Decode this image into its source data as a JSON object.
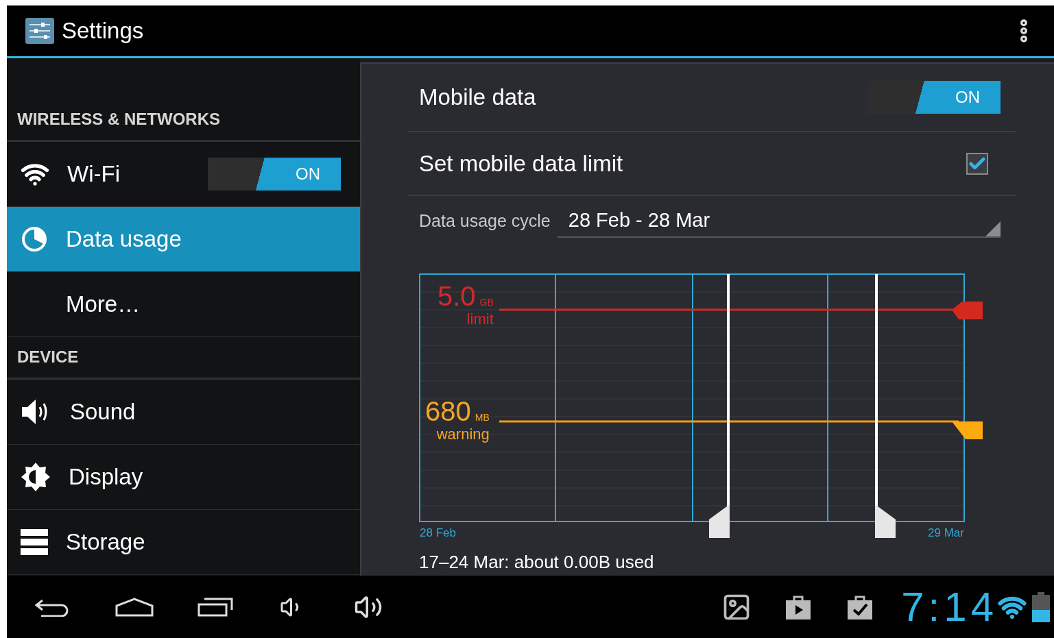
{
  "app_bar": {
    "title": "Settings"
  },
  "sidebar": {
    "sections": [
      {
        "header": "WIRELESS & NETWORKS",
        "items": [
          {
            "label": "Wi-Fi",
            "selected": false,
            "toggle": {
              "label": "ON",
              "on": true
            }
          },
          {
            "label": "Data usage",
            "selected": true
          },
          {
            "label": "More…",
            "selected": false
          }
        ]
      },
      {
        "header": "DEVICE",
        "items": [
          {
            "label": "Sound",
            "selected": false
          },
          {
            "label": "Display",
            "selected": false
          },
          {
            "label": "Storage",
            "selected": false
          }
        ]
      }
    ]
  },
  "detail": {
    "mobile_data": {
      "label": "Mobile data",
      "toggle": {
        "label": "ON",
        "on": true
      }
    },
    "data_limit": {
      "label": "Set mobile data limit",
      "checked": true
    },
    "cycle": {
      "label": "Data usage cycle",
      "value": "28 Feb - 28 Mar"
    },
    "graph": {
      "limit": {
        "value": "5.0",
        "unit": "GB",
        "label": "limit"
      },
      "warning": {
        "value": "680",
        "unit": "MB",
        "label": "warning"
      },
      "start_label": "28 Feb",
      "end_label": "29 Mar"
    },
    "summary": "17–24 Mar: about 0.00B used"
  },
  "status_bar": {
    "time": "7:14"
  }
}
